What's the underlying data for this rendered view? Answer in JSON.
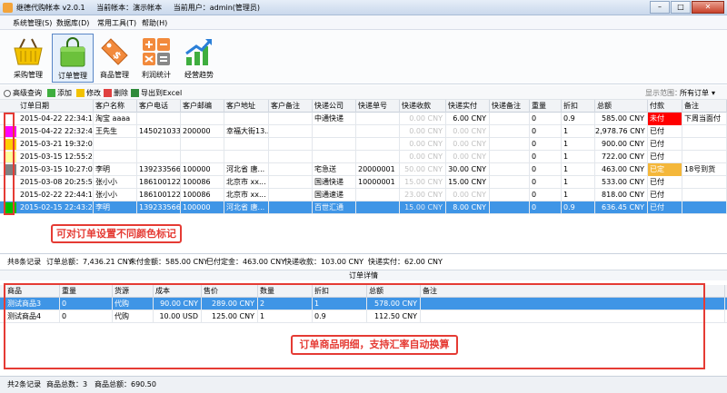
{
  "window": {
    "app_name": "继德代购帐本 v2.0.1",
    "account": "当前帐本：演示帐本",
    "user": "当前用户：admin(管理员)",
    "btn_min": "–",
    "btn_max": "□",
    "btn_close": "✕"
  },
  "menu": [
    "系统管理(S)",
    "数据库(D)",
    "常用工具(T)",
    "帮助(H)"
  ],
  "ribbon": [
    {
      "label": "采购管理",
      "icon": "basket-icon"
    },
    {
      "label": "订单管理",
      "icon": "shopping-bag-icon"
    },
    {
      "label": "商品管理",
      "icon": "price-tag-icon"
    },
    {
      "label": "利润统计",
      "icon": "calculator-icon"
    },
    {
      "label": "经营趋势",
      "icon": "trend-chart-icon"
    }
  ],
  "toolbar": {
    "search": "高级查询",
    "add": "添加",
    "edit": "修改",
    "delete": "删除",
    "export": "导出到Excel",
    "range_label": "显示范围：",
    "range_value": "所有订单"
  },
  "orders": {
    "headers": [
      "订单日期",
      "客户名称",
      "客户电话",
      "客户邮编",
      "客户地址",
      "客户备注",
      "快递公司",
      "快递单号",
      "快递收款",
      "快递实付",
      "快递备注",
      "重量",
      "折扣",
      "总额",
      "付款",
      "备注"
    ],
    "rows": [
      {
        "color": "#ffffff",
        "date": "2015-04-22 22:34:17",
        "name": "淘宝 aaaa",
        "phone": "",
        "zip": "",
        "addr": "",
        "note": "",
        "courier": "中通快递",
        "tracking": "",
        "fee_in": "0.00 CNY",
        "fee_out": "6.00 CNY",
        "courier_note": "",
        "weight": "0",
        "discount": "0.9",
        "total": "585.00 CNY",
        "paid": "未付",
        "paid_bg": "#ff0000",
        "remark": "下周当面付"
      },
      {
        "color": "#ff00ff",
        "date": "2015-04-22 22:32:49",
        "name": "王先生",
        "phone": "1450210336",
        "zip": "200000",
        "addr": "幸福大街13...",
        "note": "",
        "courier": "",
        "tracking": "",
        "fee_in": "0.00 CNY",
        "fee_out": "0.00 CNY",
        "courier_note": "",
        "weight": "0",
        "discount": "1",
        "total": "2,978.76 CNY",
        "paid": "已付",
        "paid_bg": "",
        "remark": ""
      },
      {
        "color": "#ffcc00",
        "date": "2015-03-21 19:32:09",
        "name": "",
        "phone": "",
        "zip": "",
        "addr": "",
        "note": "",
        "courier": "",
        "tracking": "",
        "fee_in": "0.00 CNY",
        "fee_out": "0.00 CNY",
        "courier_note": "",
        "weight": "0",
        "discount": "1",
        "total": "900.00 CNY",
        "paid": "已付",
        "paid_bg": "",
        "remark": ""
      },
      {
        "color": "#ffff99",
        "date": "2015-03-15 12:55:25",
        "name": "",
        "phone": "",
        "zip": "",
        "addr": "",
        "note": "",
        "courier": "",
        "tracking": "",
        "fee_in": "0.00 CNY",
        "fee_out": "0.00 CNY",
        "courier_note": "",
        "weight": "0",
        "discount": "1",
        "total": "722.00 CNY",
        "paid": "已付",
        "paid_bg": "",
        "remark": ""
      },
      {
        "color": "#808080",
        "date": "2015-03-15 10:27:03",
        "name": "李明",
        "phone": "1392335668",
        "zip": "100000",
        "addr": "河北省 唐...",
        "note": "",
        "courier": "宅急送",
        "tracking": "20000001",
        "fee_in": "50.00 CNY",
        "fee_out": "30.00 CNY",
        "courier_note": "",
        "weight": "0",
        "discount": "1",
        "total": "463.00 CNY",
        "paid": "已定",
        "paid_bg": "#f4b73a",
        "remark": "18号到货"
      },
      {
        "color": "#ffffff",
        "date": "2015-03-08 20:25:51",
        "name": "张小小",
        "phone": "1861001221",
        "zip": "100086",
        "addr": "北京市 xx...",
        "note": "",
        "courier": "国通快递",
        "tracking": "10000001",
        "fee_in": "15.00 CNY",
        "fee_out": "15.00 CNY",
        "courier_note": "",
        "weight": "0",
        "discount": "1",
        "total": "533.00 CNY",
        "paid": "已付",
        "paid_bg": "",
        "remark": ""
      },
      {
        "color": "#ffffff",
        "date": "2015-02-22 22:44:19",
        "name": "张小小",
        "phone": "1861001221",
        "zip": "100086",
        "addr": "北京市 xx...",
        "note": "",
        "courier": "国通速递",
        "tracking": "",
        "fee_in": "23.00 CNY",
        "fee_out": "0.00 CNY",
        "courier_note": "",
        "weight": "0",
        "discount": "1",
        "total": "818.00 CNY",
        "paid": "已付",
        "paid_bg": "",
        "remark": ""
      },
      {
        "color": "#00c000",
        "date": "2015-02-15 22:43:24",
        "name": "李明",
        "phone": "1392335668",
        "zip": "100000",
        "addr": "河北省 唐...",
        "note": "",
        "courier": "百世汇通",
        "tracking": "",
        "fee_in": "15.00 CNY",
        "fee_out": "8.00 CNY",
        "courier_note": "",
        "weight": "0",
        "discount": "0.9",
        "total": "636.45 CNY",
        "paid": "已付",
        "paid_bg": "",
        "remark": "",
        "selected": true
      }
    ]
  },
  "callout_color": "可对订单设置不同颜色标记",
  "order_summary": {
    "count": "共8条记录",
    "total": "订单总额：7,436.21 CNY",
    "unpaid": "未付金额：585.00 CNY",
    "deposit": "已付定金：463.00 CNY",
    "fee_in": "快递收款：103.00 CNY",
    "fee_out": "快递实付：62.00 CNY"
  },
  "detail_title": "订单详情",
  "details": {
    "headers": [
      "商品",
      "重量",
      "货源",
      "成本",
      "售价",
      "数量",
      "折扣",
      "总额",
      "备注"
    ],
    "rows": [
      {
        "item": "测试商品3",
        "weight": "0",
        "source": "代购",
        "cost": "90.00 CNY",
        "price": "289.00 CNY",
        "qty": "2",
        "discount": "1",
        "total": "578.00 CNY",
        "note": "",
        "selected": true
      },
      {
        "item": "测试商品4",
        "weight": "0",
        "source": "代购",
        "cost": "10.00 USD",
        "price": "125.00 CNY",
        "qty": "1",
        "discount": "0.9",
        "total": "112.50 CNY",
        "note": ""
      }
    ]
  },
  "callout_detail": "订单商品明细，支持汇率自动换算",
  "status": {
    "count": "共2条记录",
    "qty": "商品总数：3",
    "sum": "商品总额：690.50"
  }
}
